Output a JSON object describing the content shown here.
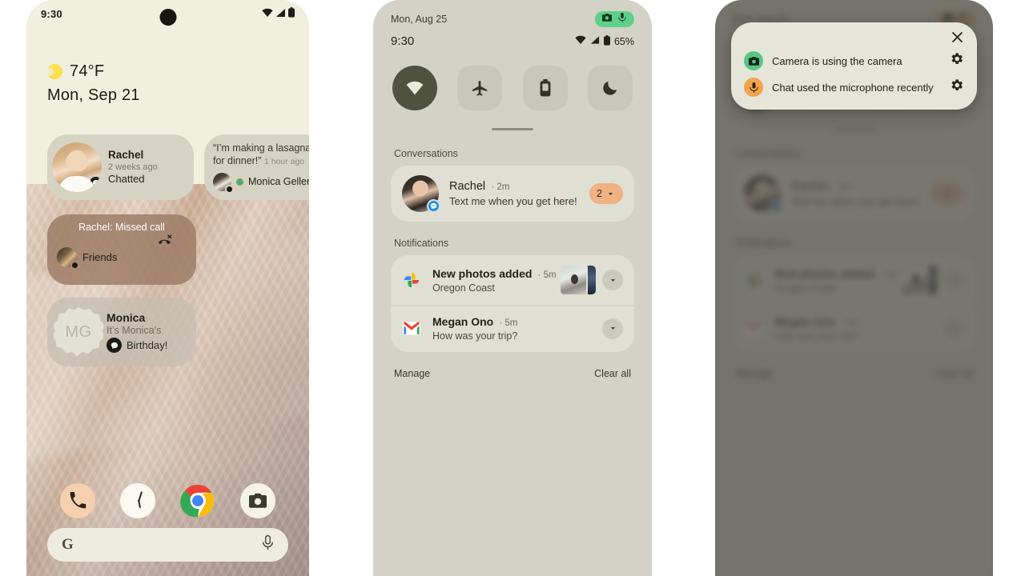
{
  "phone1": {
    "status_bar": {
      "time": "9:30",
      "icons": [
        "wifi-icon",
        "signal-icon",
        "battery-icon"
      ]
    },
    "weather": {
      "icon": "sun-icon",
      "temperature": "74°F",
      "date": "Mon, Sep 21"
    },
    "widgets": [
      {
        "name": "Rachel",
        "time": "2 weeks ago",
        "action": "Chatted",
        "badge": "messages-icon",
        "avatar": "rachel-avatar"
      },
      {
        "quote": "“I’m making a lasagna for dinner!”",
        "time": "1 hour ago",
        "name": "Monica Geller",
        "status_dot": "#5fa463",
        "badge": "messages-icon"
      },
      {
        "title": "Rachel: Missed call",
        "icon": "missed-call-icon",
        "name": "Friends",
        "badge": "messages-icon"
      },
      {
        "initials": "MG",
        "name": "Monica",
        "line1": "It’s Monica’s",
        "line2": "Birthday!",
        "badge": "messages-icon"
      }
    ],
    "dock": [
      {
        "label": "Phone",
        "icon": "phone-icon",
        "bg": "#f5cfae"
      },
      {
        "label": "Clock",
        "icon": "clock-icon",
        "bg": "#fbf9f1"
      },
      {
        "label": "Chrome",
        "icon": "chrome-icon",
        "bg": "transparent"
      },
      {
        "label": "Camera",
        "icon": "camera-icon",
        "bg": "#f5f2e7"
      }
    ],
    "search": {
      "logo": "G",
      "mic": "mic-icon",
      "placeholder": ""
    }
  },
  "phone2": {
    "date": "Mon, Aug 25",
    "privacy_pill": {
      "icons": [
        "camera-icon",
        "mic-icon"
      ],
      "color": "#5fd08a"
    },
    "time": "9:30",
    "battery": "65%",
    "status_icons": [
      "wifi-icon",
      "signal-icon",
      "battery-icon"
    ],
    "quick_settings": [
      {
        "name": "Internet",
        "icon": "wifi-icon",
        "active": true
      },
      {
        "name": "Airplane mode",
        "icon": "airplane-icon",
        "active": false
      },
      {
        "name": "Battery Saver",
        "icon": "battery-saver-icon",
        "active": false
      },
      {
        "name": "Do Not Disturb",
        "icon": "moon-icon",
        "active": false
      }
    ],
    "sections": {
      "conversations": "Conversations",
      "notifications": "Notifications"
    },
    "conversation": {
      "name": "Rachel",
      "time": "2m",
      "message": "Text me when you get here!",
      "count": "2",
      "app_badge": "messenger-icon"
    },
    "notifications": [
      {
        "app": "google-photos-icon",
        "title": "New photos added",
        "time": "5m",
        "body": "Oregon Coast",
        "has_thumbnail": true
      },
      {
        "app": "gmail-icon",
        "title": "Megan Ono",
        "time": "5m",
        "body": "How was your trip?",
        "has_thumbnail": false
      }
    ],
    "footer": {
      "manage": "Manage",
      "clear_all": "Clear all"
    }
  },
  "phone3": {
    "dialog": {
      "close": "close-icon",
      "items": [
        {
          "icon": "camera-icon",
          "icon_bg": "#57c785",
          "text": "Camera is using the camera",
          "settings": "gear-icon"
        },
        {
          "icon": "mic-icon",
          "icon_bg": "#f2a44e",
          "text": "Chat used the microphone recently",
          "settings": "gear-icon"
        }
      ]
    }
  }
}
